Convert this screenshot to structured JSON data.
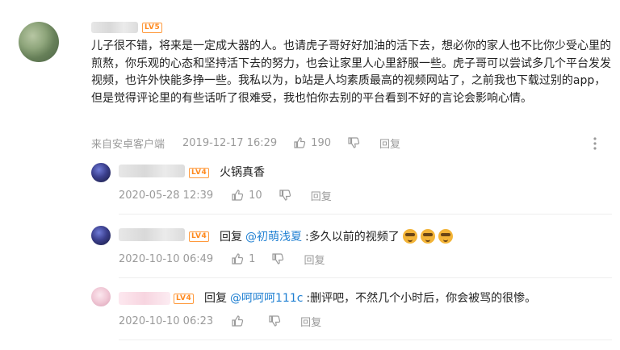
{
  "main_comment": {
    "level": "LV5",
    "text": "儿子很不错，将来是一定成大器的人。也请虎子哥好好加油的活下去，想必你的家人也不比你少受心里的煎熬，你乐观的心态和坚持活下去的努力，也会让家里人心里舒服一些。虎子哥可以尝试多几个平台发发视频，也许外快能多挣一些。我私以为，b站是人均素质最高的视频网站了，之前我也下载过别的app，但是觉得评论里的有些话听了很难受，我也怕你去别的平台看到不好的言论会影响心情。",
    "source": "来自安卓客户端",
    "time": "2019-12-17 16:29",
    "likes": "190",
    "reply_label": "回复"
  },
  "replies": [
    {
      "level": "LV4",
      "prefix": "",
      "mention": "",
      "text": "火锅真香",
      "time": "2020-05-28 12:39",
      "likes": "10",
      "reply_label": "回复"
    },
    {
      "level": "LV4",
      "prefix": "回复",
      "mention": "@初萌浅夏",
      "text": ":多久以前的视频了",
      "time": "2020-10-10 06:49",
      "likes": "1",
      "reply_label": "回复"
    },
    {
      "level": "LV4",
      "prefix": "回复",
      "mention": "@呵呵呵111c",
      "text": ":删评吧，不然几个小时后，你会被骂的很惨。",
      "time": "2020-10-10 06:23",
      "likes": "",
      "reply_label": "回复"
    }
  ],
  "colors": {
    "mention": "#1e7fd2",
    "level_badge": "#ff8a1f",
    "meta_text": "#9a9a9a"
  },
  "icons": [
    "thumb-up-icon",
    "thumb-down-icon",
    "more-vertical-icon",
    "sweat-emoji-icon"
  ]
}
